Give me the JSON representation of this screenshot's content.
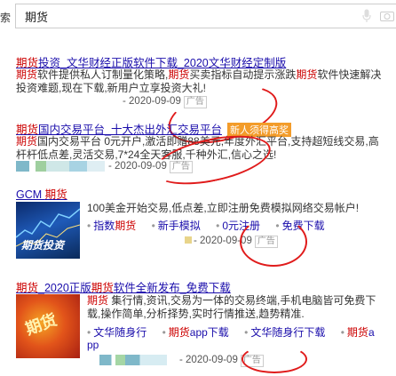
{
  "search": {
    "label": "索",
    "query": "期货"
  },
  "results": [
    {
      "title_hl": "期货",
      "title_rest": "投资_文华财经正版软件下载_2020文华财经定制版",
      "desc1_a": "期货",
      "desc1_b": "软件提供私人订制量化策略,",
      "desc1_c": "期货",
      "desc1_d": "买卖指标自动提示涨跌",
      "desc1_e": "期货",
      "desc1_f": "软件快速解决",
      "desc2": "投资难题,现在下载,新用户立享投资大礼!",
      "date": "- 2020-09-09",
      "ad": "广告"
    },
    {
      "title_hl": "期货",
      "title_rest": "国内交易平台_十大杰出外汇交易平台",
      "badge": "新人须得高奖",
      "desc1_a": "期货",
      "desc1_b": "国内交易平台 0元开户,激活即赠88美元,年度外汇平台,支持超短线交易,高",
      "desc2": "杆杆低点差,灵活交易,7*24全天客服,千种外汇,信心之选!",
      "date": "- 2020-09-09",
      "ad": "广告"
    },
    {
      "title_a": "GCM ",
      "title_hl": "期货",
      "thumb_text": "期货投资",
      "desc1": "100美金开始交易,低点差,立即注册免费模拟网络交易帐户!",
      "links": [
        {
          "pre": "指数",
          "hl": "期货",
          "post": ""
        },
        {
          "pre": "新手模拟",
          "hl": "",
          "post": ""
        },
        {
          "pre": "0元注册",
          "hl": "",
          "post": ""
        },
        {
          "pre": "免费下载",
          "hl": "",
          "post": ""
        }
      ],
      "date": "- 2020-09-09",
      "ad": "广告"
    },
    {
      "title_hl": "期货",
      "title_mid": "_2020正版",
      "title_hl2": "期货",
      "title_rest": "软件全新发布_免费下载",
      "thumb_text": "期货",
      "desc1_a": "期货",
      "desc1_b": " 集行情,资讯,交易为一体的交易终端,手机电脑皆可免费下",
      "desc2": "载,操作简单,分析择势,实时行情推送,趋势精准.",
      "links": [
        {
          "pre": "文华随身行",
          "hl": "",
          "post": ""
        },
        {
          "pre": "",
          "hl": "期货",
          "post": "app下载"
        },
        {
          "pre": "文华随身行下载",
          "hl": "",
          "post": ""
        },
        {
          "pre": "",
          "hl": "期货",
          "post": "a"
        }
      ],
      "links_wrap": "pp",
      "date": "- 2020-09-09",
      "ad": "广告"
    }
  ],
  "colors": {
    "link": "#1a0dab",
    "highlight": "#cc0000",
    "annotation_circle": "#e01b1b",
    "badge": "#f39c2a"
  }
}
